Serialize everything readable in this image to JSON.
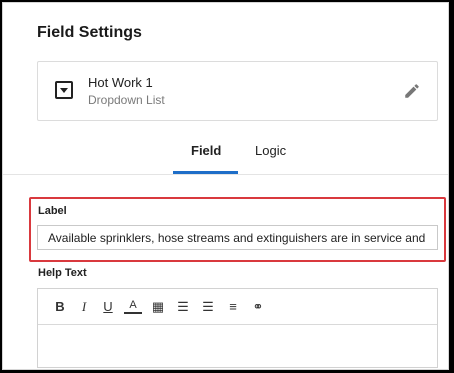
{
  "panel": {
    "title": "Field Settings"
  },
  "field_card": {
    "name": "Hot Work 1",
    "type": "Dropdown List",
    "type_icon": "dropdown-list-icon",
    "edit_icon": "pencil-icon"
  },
  "tabs": [
    {
      "label": "Field",
      "active": true
    },
    {
      "label": "Logic",
      "active": false
    }
  ],
  "label_section": {
    "heading": "Label",
    "value": "Available sprinklers, hose streams and extinguishers are in service and operable."
  },
  "help_section": {
    "heading": "Help Text",
    "toolbar": [
      {
        "name": "bold-icon",
        "glyph": "B"
      },
      {
        "name": "italic-icon",
        "glyph": "I"
      },
      {
        "name": "underline-icon",
        "glyph": "U"
      },
      {
        "name": "text-color-icon",
        "glyph": "A"
      },
      {
        "name": "highlight-icon",
        "glyph": "▦"
      },
      {
        "name": "ordered-list-icon",
        "glyph": "☰"
      },
      {
        "name": "bullet-list-icon",
        "glyph": "☰"
      },
      {
        "name": "align-left-icon",
        "glyph": "≡"
      },
      {
        "name": "link-icon",
        "glyph": "⚭"
      }
    ],
    "value": ""
  },
  "colors": {
    "accent": "#1e6ec8",
    "highlight_border": "#d9393e"
  }
}
